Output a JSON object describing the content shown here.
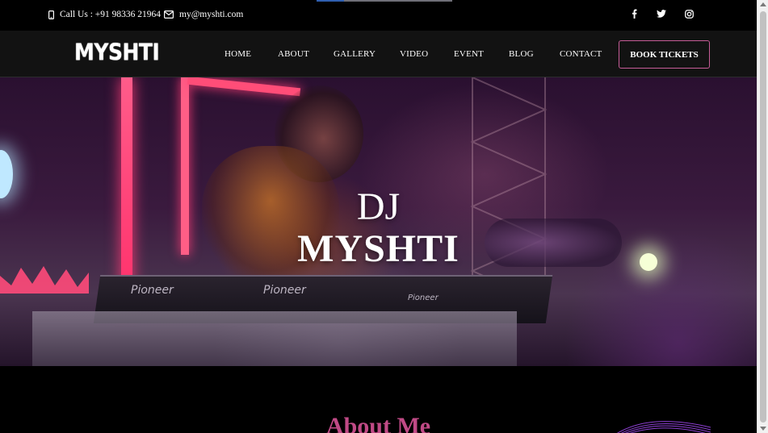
{
  "topbar": {
    "phone_text": "Call Us : +91 98336 21964",
    "email_text": "my@myshti.com",
    "social": [
      "facebook-icon",
      "twitter-icon",
      "instagram-icon"
    ]
  },
  "nav": {
    "logo": "MYSHTI",
    "links": [
      "HOME",
      "ABOUT",
      "GALLERY",
      "VIDEO",
      "EVENT",
      "BLOG",
      "CONTACT"
    ],
    "cta": "BOOK TICKETS"
  },
  "hero": {
    "title_line1": "DJ",
    "title_line2": "MYSHTI",
    "mixer_brand": "Pioneer"
  },
  "about": {
    "title": "About Me"
  },
  "colors": {
    "accent": "#c04a86",
    "button_border": "#c65c97",
    "nav_bg": "#121212",
    "topbar_bg": "#000000"
  }
}
